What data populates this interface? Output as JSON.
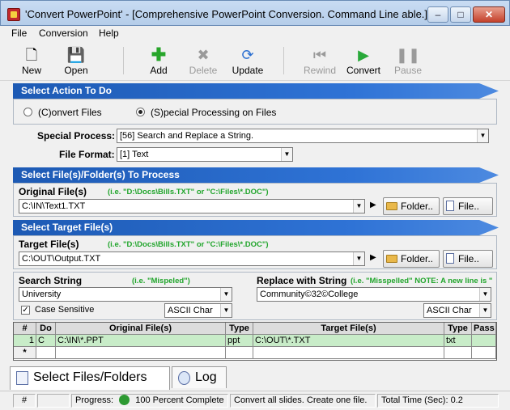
{
  "window": {
    "title": "'Convert PowerPoint' - [Comprehensive PowerPoint Conversion. Command Line able.]",
    "minimize": "–",
    "maximize": "□",
    "close": "✕"
  },
  "menu": [
    "File",
    "Conversion",
    "Help"
  ],
  "toolbar": {
    "new": "New",
    "open": "Open",
    "add": "Add",
    "delete": "Delete",
    "update": "Update",
    "rewind": "Rewind",
    "convert": "Convert",
    "pause": "Pause"
  },
  "action": {
    "header": "Select Action To Do",
    "convert_files": "(C)onvert Files",
    "special_processing": "(S)pecial Processing on Files",
    "selected": "special_processing"
  },
  "special_process": {
    "label": "Special Process:",
    "value": "[56] Search and Replace a String."
  },
  "file_format": {
    "label": "File Format:",
    "value": "[1] Text"
  },
  "source": {
    "header": "Select File(s)/Folder(s) To Process",
    "label": "Original File(s)",
    "hint": "(i.e. \"D:\\Docs\\Bills.TXT\"  or \"C:\\Files\\*.DOC\")",
    "value": "C:\\IN\\Text1.TXT",
    "folder_button": "Folder..",
    "file_button": "File.."
  },
  "target": {
    "header": "Select Target File(s)",
    "label": "Target File(s)",
    "hint": "(i.e. \"D:\\Docs\\Bills.TXT\"  or \"C:\\Files\\*.DOC\")",
    "value": "C:\\OUT\\Output.TXT",
    "folder_button": "Folder..",
    "file_button": "File.."
  },
  "search": {
    "label": "Search String",
    "hint": "(i.e. \"Mispeled\")",
    "value": "University",
    "case_sensitive": "Case Sensitive",
    "case_checked": true,
    "encoding": "ASCII Char"
  },
  "replace": {
    "label": "Replace with String",
    "hint": "(i.e. \"Misspelled\"  NOTE: A new line is \"",
    "value": "Community©32©College",
    "encoding": "ASCII Char"
  },
  "grid": {
    "columns": [
      "#",
      "Do",
      "Original File(s)",
      "Type",
      "Target File(s)",
      "Type",
      "Pass"
    ],
    "rows": [
      {
        "num": "1",
        "do": "C",
        "original": "C:\\IN\\*.PPT",
        "type": "ppt",
        "target": "C:\\OUT\\*.TXT",
        "ttype": "txt",
        "pass": ""
      }
    ],
    "new_row_marker": "*"
  },
  "tabs": [
    "Select Files/Folders",
    "Log"
  ],
  "status": {
    "hash": "#",
    "progress_label": "Progress:",
    "progress_text": "100 Percent Complete",
    "message": "Convert all slides. Create one file.",
    "time_label": "Total Time (Sec):",
    "time_value": "0.2"
  }
}
